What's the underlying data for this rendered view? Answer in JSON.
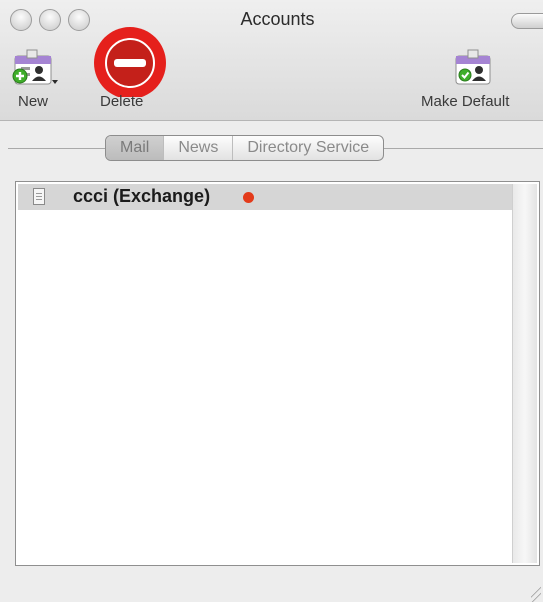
{
  "window": {
    "title": "Accounts"
  },
  "toolbar": {
    "new_label": "New",
    "delete_label": "Delete",
    "make_default_label": "Make Default"
  },
  "tabs": [
    {
      "label": "Mail",
      "selected": true
    },
    {
      "label": "News",
      "selected": false
    },
    {
      "label": "Directory Service",
      "selected": false
    }
  ],
  "accounts": [
    {
      "name": "ccci (Exchange)",
      "status_color": "#e33b1b",
      "icon": "server-icon"
    }
  ],
  "colors": {
    "delete_accent": "#e5201c",
    "add_accent": "#3fae2a"
  }
}
